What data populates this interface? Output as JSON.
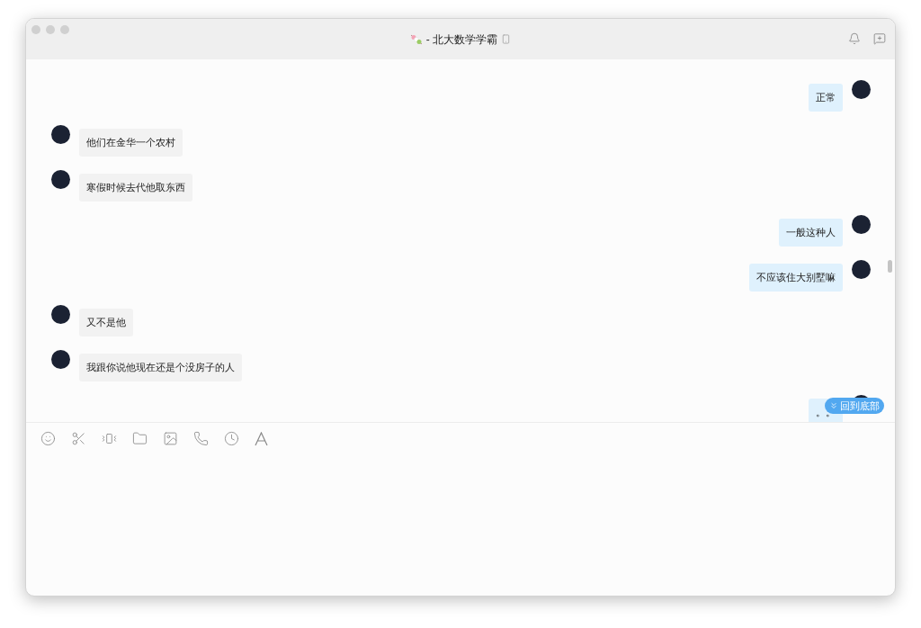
{
  "window": {
    "title": "- 北大数学学霸"
  },
  "messages": [
    {
      "kind": "sent",
      "text": "正常"
    },
    {
      "kind": "received",
      "text": "他们在金华一个农村"
    },
    {
      "kind": "received",
      "text": "寒假时候去代他取东西"
    },
    {
      "kind": "sent",
      "text": "一般这种人"
    },
    {
      "kind": "sent",
      "text": "不应该住大别墅嘛"
    },
    {
      "kind": "received",
      "text": "又不是他"
    },
    {
      "kind": "received",
      "text": "我跟你说他现在还是个没房子的人"
    },
    {
      "kind": "sent",
      "text": "。。"
    }
  ],
  "scroll_button": {
    "label": "回到底部"
  }
}
